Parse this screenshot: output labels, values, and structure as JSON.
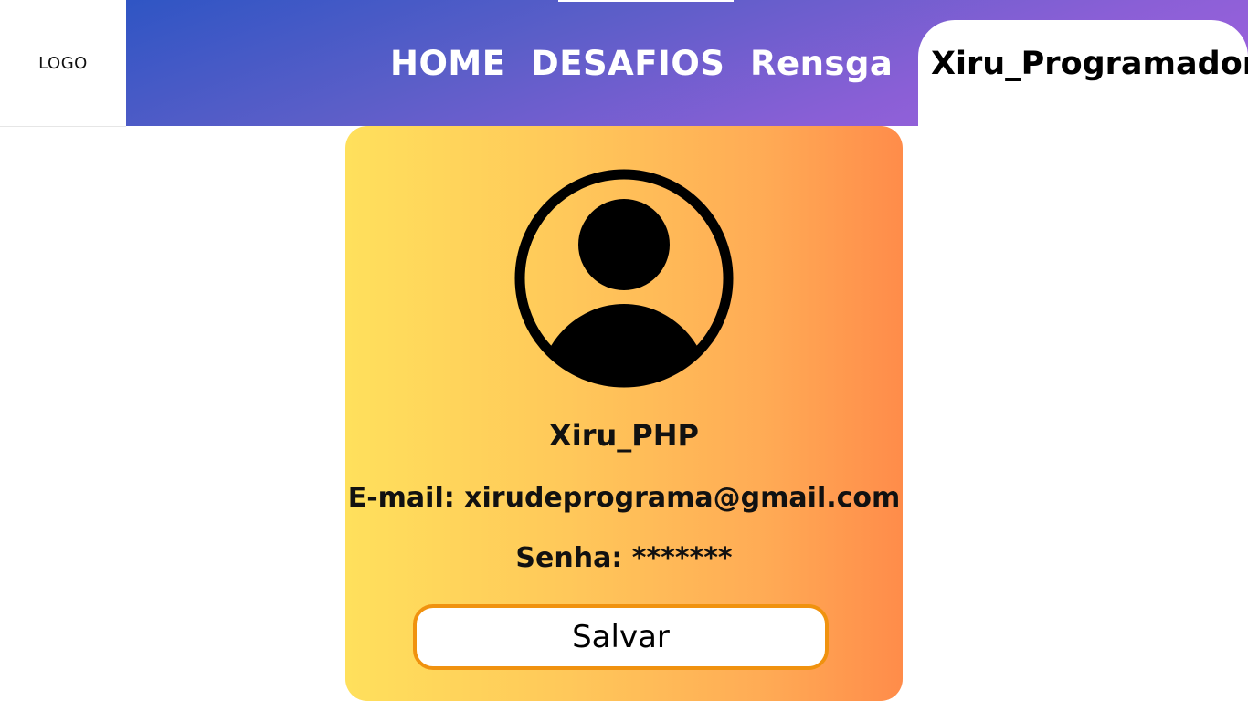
{
  "logo": {
    "label": "LOGO"
  },
  "nav": {
    "home": "HOME",
    "desafios": "DESAFIOS",
    "rensga": "Rensga"
  },
  "user_tab": {
    "label": "Xiru_Programador"
  },
  "profile": {
    "avatar_icon": "user-circle-icon",
    "username": "Xiru_PHP",
    "email": "E-mail: xirudeprograma@gmail.com",
    "password": "Senha: *******",
    "save_label": "Salvar"
  },
  "colors": {
    "header_gradient_start": "#2f55c4",
    "header_gradient_end": "#a463e0",
    "card_gradient_start": "#ffe05c",
    "card_gradient_end": "#ff8c4a",
    "button_border": "#f0920f"
  }
}
